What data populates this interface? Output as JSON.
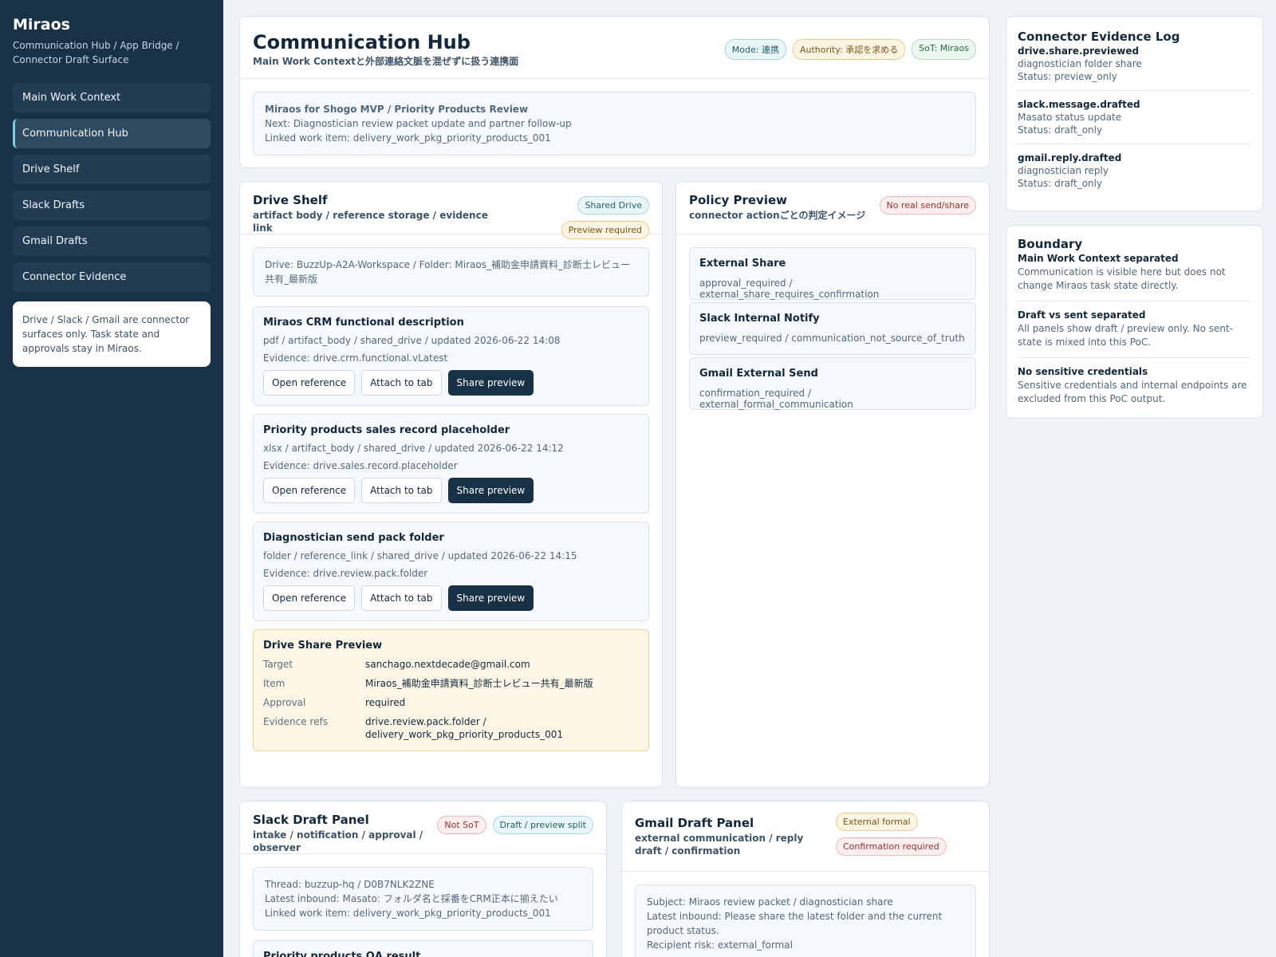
{
  "sidebar": {
    "brand": "Miraos",
    "subtitle": "Communication Hub / App Bridge / Connector Draft Surface",
    "nav": [
      {
        "label": "Main Work Context"
      },
      {
        "label": "Communication Hub"
      },
      {
        "label": "Drive Shelf"
      },
      {
        "label": "Slack Drafts"
      },
      {
        "label": "Gmail Drafts"
      },
      {
        "label": "Connector Evidence"
      }
    ],
    "active_index": 1,
    "note": "Drive / Slack / Gmail are connector surfaces only. Task state and approvals stay in Miraos."
  },
  "hub": {
    "title": "Communication Hub",
    "subtitle": "Main Work Contextと外部連絡文脈を混ぜずに扱う連携面",
    "badges": [
      "Mode: 連携",
      "Authority: 承認を求める",
      "SoT: Miraos"
    ],
    "context_title": "Miraos for Shogo MVP / Priority Products Review",
    "context_next": "Next: Diagnostician review packet update and partner follow-up",
    "context_linked": "Linked work item: delivery_work_pkg_priority_products_001"
  },
  "drive": {
    "title": "Drive Shelf",
    "subtitle": "artifact body / reference storage / evidence link",
    "badges": [
      "Shared Drive",
      "Preview required"
    ],
    "location": "Drive: BuzzUp-A2A-Workspace / Folder: Miraos_補助金申請資料_診断士レビュー共有_最新版",
    "button_labels": {
      "open": "Open reference",
      "attach": "Attach to tab",
      "share": "Share preview"
    },
    "items": [
      {
        "title": "Miraos CRM functional description",
        "meta": "pdf / artifact_body / shared_drive / updated 2026-06-22 14:08",
        "evidence": "Evidence: drive.crm.functional.vLatest"
      },
      {
        "title": "Priority products sales record placeholder",
        "meta": "xlsx / artifact_body / shared_drive / updated 2026-06-22 14:12",
        "evidence": "Evidence: drive.sales.record.placeholder"
      },
      {
        "title": "Diagnostician send pack folder",
        "meta": "folder / reference_link / shared_drive / updated 2026-06-22 14:15",
        "evidence": "Evidence: drive.review.pack.folder"
      }
    ],
    "share_preview": {
      "title": "Drive Share Preview",
      "rows": [
        {
          "k": "Target",
          "v": "sanchago.nextdecade@gmail.com"
        },
        {
          "k": "Item",
          "v": "Miraos_補助金申請資料_診断士レビュー共有_最新版"
        },
        {
          "k": "Approval",
          "v": "required"
        },
        {
          "k": "Evidence refs",
          "v": "drive.review.pack.folder / delivery_work_pkg_priority_products_001"
        }
      ]
    }
  },
  "policy": {
    "title": "Policy Preview",
    "subtitle": "connector actionごとの判定イメージ",
    "badge": "No real send/share",
    "items": [
      {
        "title": "External Share",
        "desc": "approval_required / external_share_requires_confirmation"
      },
      {
        "title": "Slack Internal Notify",
        "desc": "preview_required / communication_not_source_of_truth"
      },
      {
        "title": "Gmail External Send",
        "desc": "confirmation_required / external_formal_communication"
      }
    ]
  },
  "evidence_log": {
    "title": "Connector Evidence Log",
    "entries": [
      {
        "event": "drive.share.previewed",
        "detail": "diagnostician folder share",
        "status": "Status: preview_only"
      },
      {
        "event": "slack.message.drafted",
        "detail": "Masato status update",
        "status": "Status: draft_only"
      },
      {
        "event": "gmail.reply.drafted",
        "detail": "diagnostician reply",
        "status": "Status: draft_only"
      }
    ]
  },
  "boundary": {
    "title": "Boundary",
    "entries": [
      {
        "title": "Main Work Context separated",
        "desc": "Communication is visible here but does not change Miraos task state directly."
      },
      {
        "title": "Draft vs sent separated",
        "desc": "All panels show draft / preview only. No sent-state is mixed into this PoC."
      },
      {
        "title": "No sensitive credentials",
        "desc": "Sensitive credentials and internal endpoints are excluded from this PoC output."
      }
    ]
  },
  "slack": {
    "title": "Slack Draft Panel",
    "subtitle": "intake / notification / approval / observer",
    "badges": [
      "Not SoT",
      "Draft / preview split"
    ],
    "thread": "Thread: buzzup-hq / D0B7NLK2ZNE",
    "inbound": "Latest inbound: Masato: フォルダ名と採番をCRM正本に揃えたい",
    "linked": "Linked work item: delivery_work_pkg_priority_products_001",
    "next_card_title": "Priority products QA result"
  },
  "gmail": {
    "title": "Gmail Draft Panel",
    "subtitle": "external communication / reply draft / confirmation",
    "badges": [
      "External formal",
      "Confirmation required"
    ],
    "subject": "Subject: Miraos review packet / diagnostician share",
    "inbound": "Latest inbound: Please share the latest folder and the current product status.",
    "risk": "Recipient risk: external_formal"
  }
}
